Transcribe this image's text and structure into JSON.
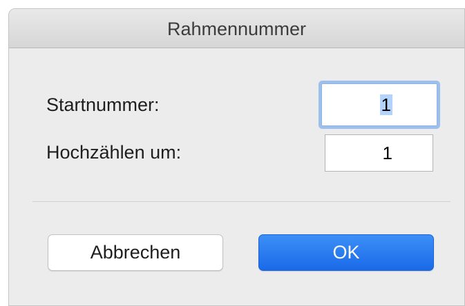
{
  "dialog": {
    "title": "Rahmennummer",
    "start_label": "Startnummer:",
    "start_value": "1",
    "step_label": "Hochzählen um:",
    "step_value": "1",
    "cancel_label": "Abbrechen",
    "ok_label": "OK"
  },
  "colors": {
    "accent": "#1a6ae8",
    "focus_ring": "#9dbfee",
    "selection": "#b3d3fd",
    "background": "#ececec"
  }
}
